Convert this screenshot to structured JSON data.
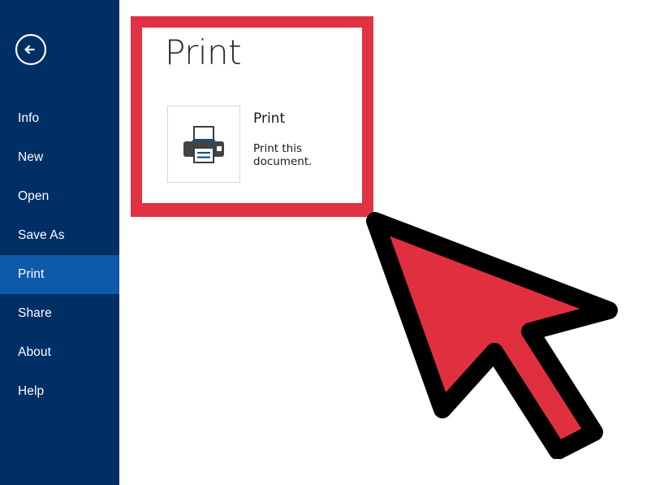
{
  "app": {
    "background_color": "#ffffff"
  },
  "sidebar": {
    "background_color": "#002f65",
    "selected_color": "#0f5aa8",
    "back_button": {
      "name": "back-arrow-button",
      "icon": "arrow-left-circle-icon",
      "label": "Back"
    },
    "items": [
      {
        "label": "Info",
        "selected": false
      },
      {
        "label": "New",
        "selected": false
      },
      {
        "label": "Open",
        "selected": false
      },
      {
        "label": "Save As",
        "selected": false
      },
      {
        "label": "Print",
        "selected": true
      },
      {
        "label": "Share",
        "selected": false
      },
      {
        "label": "About",
        "selected": false
      },
      {
        "label": "Help",
        "selected": false
      }
    ]
  },
  "print_panel": {
    "highlight_border_color": "#e03243",
    "heading": "Print",
    "tile": {
      "icon": "printer-icon",
      "title": "Print",
      "description": "Print this document."
    }
  },
  "cursor": {
    "icon": "mouse-pointer-arrow-icon",
    "fill_color": "#e0303f",
    "outline_color": "#000000"
  }
}
